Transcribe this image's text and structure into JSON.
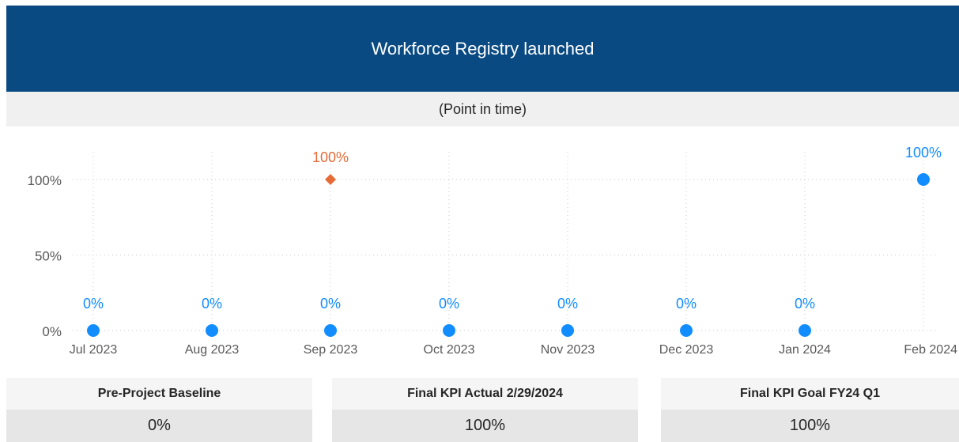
{
  "header": {
    "title": "Workforce Registry launched"
  },
  "subheader": {
    "text": "(Point in time)"
  },
  "colors": {
    "header_bg": "#0a4a83",
    "series_blue": "#118dff",
    "series_orange": "#e66c37"
  },
  "chart_data": {
    "type": "scatter",
    "title": "",
    "xlabel": "",
    "ylabel": "",
    "categories": [
      "Jul 2023",
      "Aug 2023",
      "Sep 2023",
      "Oct 2023",
      "Nov 2023",
      "Dec 2023",
      "Jan 2024",
      "Feb 2024"
    ],
    "y_ticks": [
      "0%",
      "50%",
      "100%"
    ],
    "ylim": [
      0,
      1.0
    ],
    "grid": "dotted",
    "series": [
      {
        "marker": "circle",
        "color": "#118dff",
        "values": [
          0,
          0,
          0,
          0,
          0,
          0,
          0,
          1.0
        ],
        "labels": [
          "0%",
          "0%",
          "0%",
          "0%",
          "0%",
          "0%",
          "0%",
          "100%"
        ]
      },
      {
        "marker": "diamond",
        "color": "#e66c37",
        "points": [
          {
            "category": "Sep 2023",
            "value": 1.0,
            "label": "100%"
          }
        ]
      }
    ]
  },
  "kpis": [
    {
      "label": "Pre-Project Baseline",
      "value": "0%"
    },
    {
      "label": "Final KPI Actual 2/29/2024",
      "value": "100%"
    },
    {
      "label": "Final KPI Goal FY24 Q1",
      "value": "100%"
    }
  ]
}
